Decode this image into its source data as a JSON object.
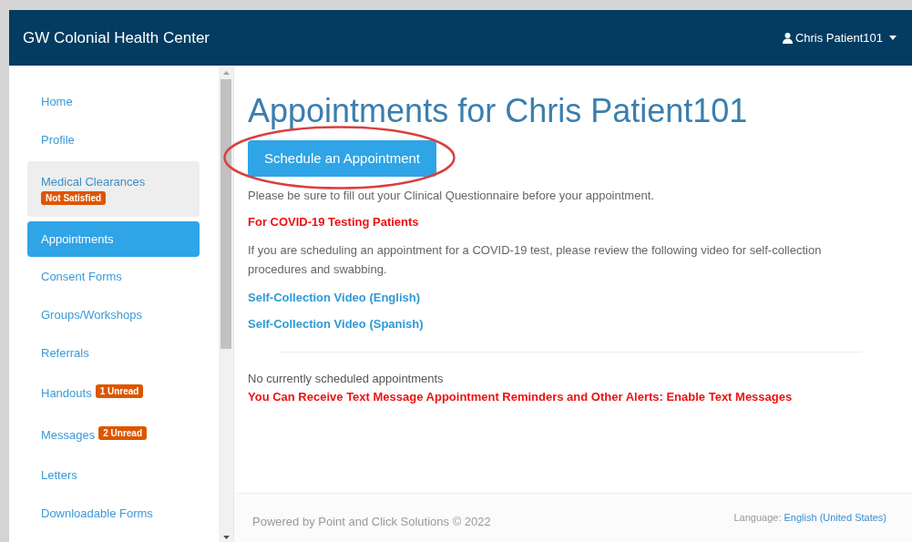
{
  "header": {
    "title": "GW Colonial Health Center",
    "user": "Chris Patient101"
  },
  "sidebar": {
    "items": [
      {
        "label": "Home",
        "selected": false,
        "shaded": false
      },
      {
        "label": "Profile",
        "selected": false,
        "shaded": false
      },
      {
        "label": "Medical Clearances",
        "selected": false,
        "shaded": true,
        "badge": "Not Satisfied"
      },
      {
        "label": "Appointments",
        "selected": true,
        "shaded": false
      },
      {
        "label": "Consent Forms",
        "selected": false,
        "shaded": false
      },
      {
        "label": "Groups/Workshops",
        "selected": false,
        "shaded": false
      },
      {
        "label": "Referrals",
        "selected": false,
        "shaded": false
      },
      {
        "label": "Handouts",
        "selected": false,
        "shaded": false,
        "badge": "1 Unread"
      },
      {
        "label": "Messages",
        "selected": false,
        "shaded": false,
        "badge": "2 Unread"
      },
      {
        "label": "Letters",
        "selected": false,
        "shaded": false
      },
      {
        "label": "Downloadable Forms",
        "selected": false,
        "shaded": false
      }
    ]
  },
  "main": {
    "title": "Appointments for Chris Patient101",
    "schedule_button": {
      "label": "Schedule an Appointment",
      "circled": true
    },
    "notice": "Please be sure to fill out your Clinical Questionnaire before your appointment.",
    "covid_heading": "For COVID-19 Testing Patients",
    "covid_text": "If you are scheduling an appointment for a COVID-19 test, please review the following video for self-collection procedures and swabbing.",
    "links": [
      "Self-Collection Video (English)",
      "Self-Collection Video (Spanish)"
    ],
    "no_appointments": "No currently scheduled appointments",
    "sms_alert": "You Can Receive Text Message Appointment Reminders and Other Alerts: Enable Text Messages"
  },
  "footer": {
    "powered_by": "Powered by Point and Click Solutions © 2022",
    "language_label": "Language:",
    "language_value": "English (United States)"
  }
}
